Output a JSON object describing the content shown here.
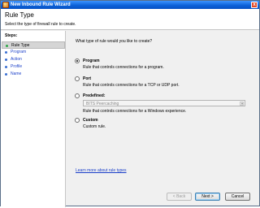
{
  "window": {
    "title": "New Inbound Rule Wizard",
    "close_glyph": "x"
  },
  "header": {
    "title": "Rule Type",
    "subtitle": "Select the type of firewall rule to create."
  },
  "sidebar": {
    "heading": "Steps:",
    "items": [
      {
        "label": "Rule Type",
        "state": "current"
      },
      {
        "label": "Program",
        "state": "link"
      },
      {
        "label": "Action",
        "state": "link"
      },
      {
        "label": "Profile",
        "state": "link"
      },
      {
        "label": "Name",
        "state": "link"
      }
    ]
  },
  "main": {
    "question": "What type of rule would you like to create?",
    "options": [
      {
        "label": "Program",
        "description": "Rule that controls connections for a program.",
        "checked": true
      },
      {
        "label": "Port",
        "description": "Rule that controls connections for a TCP or UDP port.",
        "checked": false
      },
      {
        "label": "Predefined:",
        "select_value": "BITS Peercaching",
        "description": "Rule that controls connections for a Windows experience.",
        "checked": false
      },
      {
        "label": "Custom",
        "description": "Custom rule.",
        "checked": false
      }
    ],
    "learn_more": "Learn more about rule types"
  },
  "footer": {
    "back": "< Back",
    "next": "Next >",
    "cancel": "Cancel"
  },
  "colors": {
    "title_bar": "#0a5fd6",
    "link": "#1a3fc9",
    "step_bullet": "#2fa84a"
  }
}
